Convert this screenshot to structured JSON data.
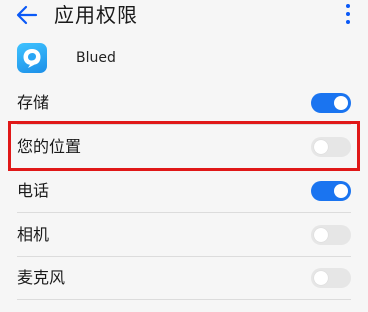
{
  "header": {
    "title": "应用权限"
  },
  "app": {
    "name": "Blued",
    "icon": "blued-app-icon"
  },
  "permissions": [
    {
      "label": "存储",
      "enabled": true
    },
    {
      "label": "您的位置",
      "enabled": false,
      "highlighted": true
    },
    {
      "label": "电话",
      "enabled": true
    },
    {
      "label": "相机",
      "enabled": false
    },
    {
      "label": "麦克风",
      "enabled": false
    }
  ],
  "colors": {
    "accent": "#0a59f7",
    "toggle_on": "#1a74f0",
    "toggle_off": "#e6e6e6",
    "highlight": "#e01818",
    "background": "#f6f6f6"
  },
  "icons": {
    "back": "back-arrow-icon",
    "menu": "more-vertical-icon"
  }
}
